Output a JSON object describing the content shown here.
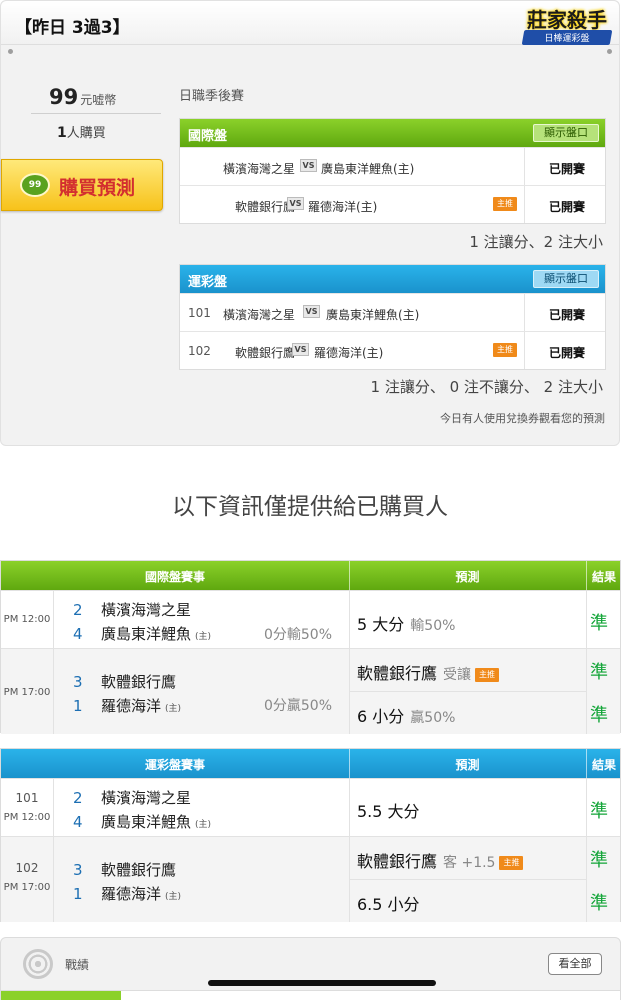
{
  "header": {
    "title": "【昨日 3過3】",
    "badge_title": "莊家殺手",
    "badge_sub": "日棒運彩盤"
  },
  "purchase": {
    "price": "99",
    "unit": "元嘘幣",
    "buyers_count": "1",
    "buyers_label": "人購買",
    "button_label": "購買預測",
    "coin_text": "99"
  },
  "season": "日職季後賽",
  "intl_panel": {
    "title": "國際盤",
    "show_label": "顯示盤口",
    "rows": [
      {
        "home": "橫濱海灣之星",
        "away": "廣島東洋鯉魚(主)",
        "status": "已開賽",
        "main": ""
      },
      {
        "home": "軟體銀行鷹",
        "away": "羅德海洋(主)",
        "status": "已開賽",
        "main": "主推"
      }
    ],
    "summary": "1 注讓分、2 注大小"
  },
  "sport_panel": {
    "title": "運彩盤",
    "show_label": "顯示盤口",
    "rows": [
      {
        "code": "101",
        "home": "橫濱海灣之星",
        "away": "廣島東洋鯉魚(主)",
        "status": "已開賽",
        "main": ""
      },
      {
        "code": "102",
        "home": "軟體銀行鷹",
        "away": "羅德海洋(主)",
        "status": "已開賽",
        "main": "主推"
      }
    ],
    "summary": "1 注讓分、 0 注不讓分、 2 注大小",
    "note": "今日有人使用兌換券觀看您的預測"
  },
  "headline": "以下資訊僅提供給已購買人",
  "intl_table": {
    "headers": {
      "games": "國際盤賽事",
      "pred": "預測",
      "result": "結果"
    },
    "vs_icon": "VS",
    "home_mark": "(主)",
    "groups": [
      {
        "time": "PM 12:00",
        "t1_score": "2",
        "t1": "橫濱海灣之星",
        "t2_score": "4",
        "t2": "廣島東洋鯉魚",
        "odds": "0分輸50%",
        "preds": [
          {
            "main": "5 大分",
            "sub": "輸50%",
            "tag": "",
            "result": "準"
          }
        ]
      },
      {
        "time": "PM 17:00",
        "t1_score": "3",
        "t1": "軟體銀行鷹",
        "t2_score": "1",
        "t2": "羅德海洋",
        "odds": "0分贏50%",
        "preds": [
          {
            "main": "軟體銀行鷹",
            "sub": "受讓",
            "tag": "主推",
            "result": "準"
          },
          {
            "main": "6 小分",
            "sub": "贏50%",
            "tag": "",
            "result": "準"
          }
        ]
      }
    ]
  },
  "sport_table": {
    "headers": {
      "games": "運彩盤賽事",
      "pred": "預測",
      "result": "結果"
    },
    "home_mark": "(主)",
    "groups": [
      {
        "code": "101",
        "time": "PM 12:00",
        "t1_score": "2",
        "t1": "橫濱海灣之星",
        "t2_score": "4",
        "t2": "廣島東洋鯉魚",
        "preds": [
          {
            "main": "5.5 大分",
            "sub": "",
            "tag": "",
            "result": "準"
          }
        ]
      },
      {
        "code": "102",
        "time": "PM 17:00",
        "t1_score": "3",
        "t1": "軟體銀行鷹",
        "t2_score": "1",
        "t2": "羅德海洋",
        "preds": [
          {
            "main": "軟體銀行鷹",
            "sub": "客 +1.5",
            "tag": "主推",
            "result": "準"
          },
          {
            "main": "6.5 小分",
            "sub": "",
            "tag": "",
            "result": "準"
          }
        ]
      }
    ]
  },
  "stats": {
    "label": "戰績",
    "view_all": "看全部"
  },
  "colors": {
    "green": "#5fa80f",
    "blue": "#1a92cc",
    "result_green": "#13a538",
    "main_tag": "#f08a1a"
  }
}
